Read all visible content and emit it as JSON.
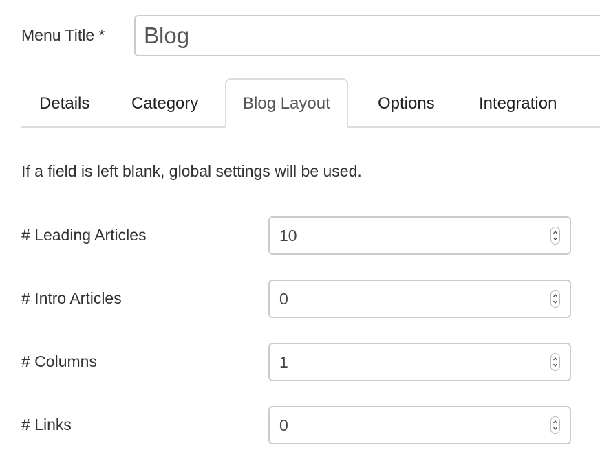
{
  "menu_title": {
    "label": "Menu Title *",
    "value": "Blog"
  },
  "tabs": [
    {
      "label": "Details",
      "active": false
    },
    {
      "label": "Category",
      "active": false
    },
    {
      "label": "Blog Layout",
      "active": true
    },
    {
      "label": "Options",
      "active": false
    },
    {
      "label": "Integration",
      "active": false
    }
  ],
  "note": "If a field is left blank, global settings will be used.",
  "fields": [
    {
      "label": "# Leading Articles",
      "value": "10"
    },
    {
      "label": "# Intro Articles",
      "value": "0"
    },
    {
      "label": "# Columns",
      "value": "1"
    },
    {
      "label": "# Links",
      "value": "0"
    }
  ],
  "icons": {
    "spinner": "up-down-spinner-icon"
  }
}
